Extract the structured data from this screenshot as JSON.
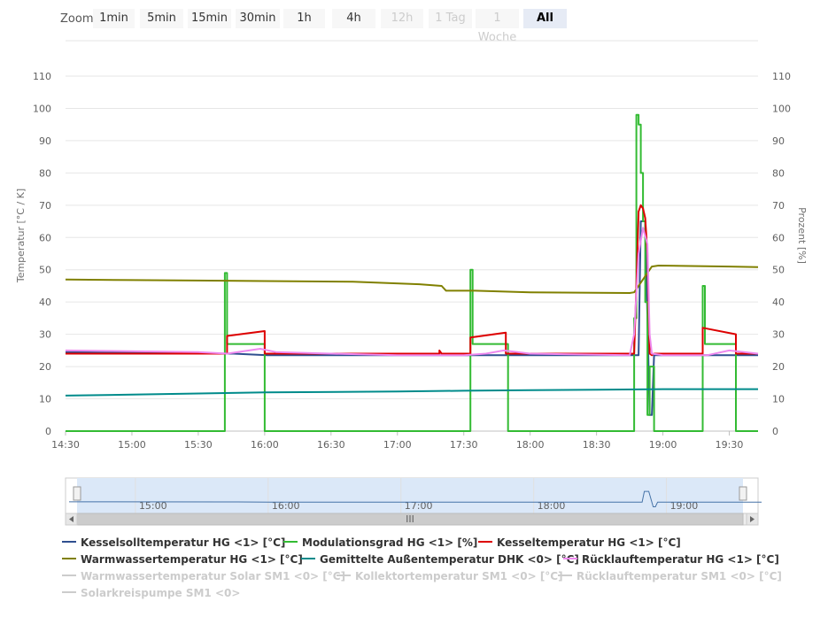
{
  "zoom": {
    "label": "Zoom",
    "buttons": [
      {
        "label": "1min",
        "state": "normal"
      },
      {
        "label": "5min",
        "state": "normal"
      },
      {
        "label": "15min",
        "state": "normal"
      },
      {
        "label": "30min",
        "state": "normal"
      },
      {
        "label": "1h",
        "state": "normal"
      },
      {
        "label": "4h",
        "state": "normal"
      },
      {
        "label": "12h",
        "state": "disabled"
      },
      {
        "label": "1 Tag",
        "state": "disabled"
      },
      {
        "label": "1 Woche",
        "state": "disabled"
      },
      {
        "label": "All",
        "state": "selected"
      }
    ]
  },
  "chart_data": {
    "type": "line",
    "ylabel": "Temperatur [°C / K]",
    "ylabel_right": "Prozent [%]",
    "ylim": [
      0,
      110
    ],
    "ylim_right": [
      0,
      110
    ],
    "yticks": [
      0,
      10,
      20,
      30,
      40,
      50,
      60,
      70,
      80,
      90,
      100,
      110
    ],
    "xlim": [
      "14:30",
      "19:43"
    ],
    "xticks": [
      "14:30",
      "15:00",
      "15:30",
      "16:00",
      "16:30",
      "17:00",
      "17:30",
      "18:00",
      "18:30",
      "19:00",
      "19:30"
    ],
    "grid": true,
    "legend_position": "bottom",
    "navigator": {
      "labels": [
        "15:00",
        "16:00",
        "17:00",
        "18:00",
        "19:00"
      ],
      "scrollbar_grip": "III"
    },
    "series": [
      {
        "name": "Kesselsolltemperatur HG <1> [°C]",
        "color": "#2f4f8f",
        "visible": true,
        "x": [
          "14:30",
          "15:45",
          "15:46",
          "16:01",
          "17:30",
          "18:49",
          "18:50",
          "18:52",
          "18:54",
          "18:55",
          "18:56",
          "19:43"
        ],
        "y": [
          24.5,
          24,
          24,
          23.5,
          23.5,
          23.5,
          65,
          65,
          5,
          5,
          23.5,
          23.5
        ]
      },
      {
        "name": "Modulationsgrad HG <1> [%]",
        "color": "#33bb33",
        "visible": true,
        "x": [
          "14:30",
          "15:42",
          "15:42",
          "15:43",
          "15:43",
          "15:45",
          "15:45",
          "15:58",
          "15:58",
          "16:00",
          "16:00",
          "17:33",
          "17:33",
          "17:34",
          "17:34",
          "17:36",
          "17:36",
          "17:47",
          "17:47",
          "17:50",
          "17:50",
          "18:47",
          "18:47",
          "18:48",
          "18:48",
          "18:49",
          "18:49",
          "18:50",
          "18:50",
          "18:51",
          "18:51",
          "18:52",
          "18:52",
          "18:53",
          "18:53",
          "18:54",
          "18:54",
          "18:56",
          "18:56",
          "18:58",
          "18:58",
          "19:18",
          "19:18",
          "19:19",
          "19:19",
          "19:21",
          "19:21",
          "19:33",
          "19:33",
          "19:43"
        ],
        "y": [
          0,
          0,
          49,
          49,
          27,
          27,
          27,
          27,
          27,
          27,
          0,
          0,
          50,
          50,
          27,
          27,
          27,
          27,
          27,
          27,
          0,
          0,
          35,
          35,
          98,
          98,
          95,
          95,
          80,
          80,
          65,
          65,
          40,
          40,
          5,
          5,
          20,
          20,
          0,
          0,
          0,
          0,
          45,
          45,
          27,
          27,
          27,
          27,
          0,
          0
        ]
      },
      {
        "name": "Kesselte­mperatur HG <1> [°C]",
        "color": "#dd0000",
        "visible": true,
        "x": [
          "14:30",
          "15:43",
          "15:43",
          "16:00",
          "16:00",
          "17:19",
          "17:19",
          "17:20",
          "17:33",
          "17:33",
          "17:49",
          "17:49",
          "18:47",
          "18:48",
          "18:49",
          "18:50",
          "18:51",
          "18:52",
          "18:53",
          "18:54",
          "18:55",
          "18:56",
          "19:18",
          "19:18",
          "19:33",
          "19:33",
          "19:43"
        ],
        "y": [
          24,
          24,
          29.5,
          31,
          24,
          24,
          25,
          24,
          24,
          29,
          30.5,
          24,
          24,
          45,
          68,
          70,
          69,
          66,
          55,
          24,
          23.5,
          24,
          24,
          32,
          30,
          24,
          24
        ]
      },
      {
        "name": "Warmwassertemperatur HG <1> [°C]",
        "color": "#808000",
        "visible": true,
        "x": [
          "14:30",
          "15:00",
          "16:00",
          "16:40",
          "17:10",
          "17:20",
          "17:22",
          "17:35",
          "18:00",
          "18:45",
          "18:47",
          "18:50",
          "18:55",
          "18:58",
          "19:30",
          "19:43"
        ],
        "y": [
          47,
          46.8,
          46.5,
          46.3,
          45.5,
          45,
          43.5,
          43.5,
          43,
          42.8,
          43,
          46,
          51,
          51.3,
          51,
          50.8
        ]
      },
      {
        "name": "Gemittelte Außentemperatur DHK <0> [°C]",
        "color": "#008b8b",
        "visible": true,
        "x": [
          "14:30",
          "15:00",
          "16:00",
          "17:00",
          "17:30",
          "18:00",
          "18:30",
          "19:00",
          "19:43"
        ],
        "y": [
          11,
          11.3,
          12,
          12.3,
          12.5,
          12.7,
          12.8,
          13,
          13
        ]
      },
      {
        "name": "Rücklauftemperatur HG <1> [°C]",
        "color": "#ee88ee",
        "visible": true,
        "x": [
          "14:30",
          "15:30",
          "15:43",
          "15:58",
          "16:05",
          "16:30",
          "17:00",
          "17:30",
          "17:40",
          "17:48",
          "18:00",
          "18:45",
          "18:47",
          "18:49",
          "18:51",
          "18:53",
          "18:54",
          "18:55",
          "19:00",
          "19:20",
          "19:30",
          "19:43"
        ],
        "y": [
          25,
          24.5,
          24,
          25.5,
          24.5,
          24,
          23.5,
          23.5,
          24,
          25,
          24,
          23.5,
          30,
          55,
          63,
          58,
          30,
          24,
          23.5,
          23.5,
          25,
          24
        ]
      },
      {
        "name": "Warmwassertemperatur Solar SM1 <0> [°C]",
        "color": "#cccccc",
        "visible": false,
        "x": [],
        "y": []
      },
      {
        "name": "Kollektortemperatur SM1 <0> [°C]",
        "color": "#cccccc",
        "visible": false,
        "x": [],
        "y": []
      },
      {
        "name": "Rücklauftemperatur SM1 <0> [°C]",
        "color": "#cccccc",
        "visible": false,
        "x": [],
        "y": []
      },
      {
        "name": "Solarkreispumpe SM1 <0>",
        "color": "#cccccc",
        "visible": false,
        "x": [],
        "y": []
      }
    ]
  }
}
